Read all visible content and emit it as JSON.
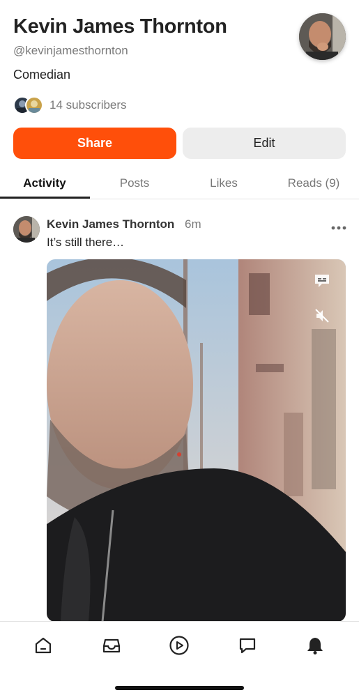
{
  "profile": {
    "name": "Kevin James Thornton",
    "handle": "@kevinjamesthornton",
    "bio": "Comedian",
    "subscribers_text": "14 subscribers"
  },
  "actions": {
    "share_label": "Share",
    "edit_label": "Edit"
  },
  "tabs": [
    {
      "label": "Activity",
      "active": true
    },
    {
      "label": "Posts",
      "active": false
    },
    {
      "label": "Likes",
      "active": false
    },
    {
      "label": "Reads (9)",
      "active": false
    }
  ],
  "post": {
    "author": "Kevin James Thornton",
    "time": "6m",
    "text": "It’s still there…",
    "media_type": "video",
    "muted": true
  },
  "bottom_nav": [
    {
      "icon": "home-icon",
      "active": false
    },
    {
      "icon": "inbox-icon",
      "active": false
    },
    {
      "icon": "play-icon",
      "active": false
    },
    {
      "icon": "chat-icon",
      "active": false
    },
    {
      "icon": "bell-icon",
      "active": true
    }
  ],
  "colors": {
    "accent": "#ff4f0a",
    "secondary_button": "#ededed",
    "muted_text": "#7a7a7a"
  }
}
